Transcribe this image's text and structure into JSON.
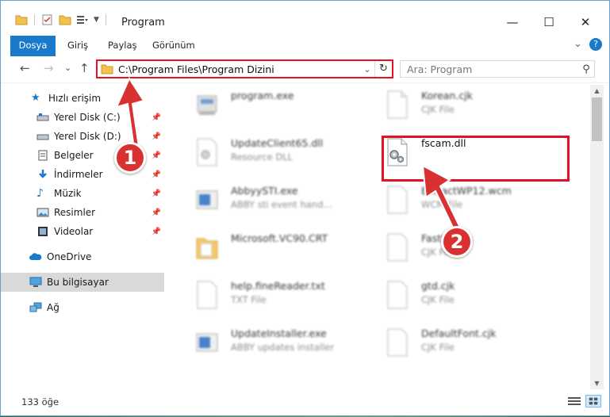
{
  "window": {
    "title": "Program",
    "controls": {
      "minimize": "—",
      "maximize": "☐",
      "close": "✕"
    }
  },
  "ribbon": {
    "tabs": [
      "Dosya",
      "Giriş",
      "Paylaş",
      "Görünüm"
    ],
    "collapse_icon": "chevron-down-icon",
    "help_icon": "help-icon"
  },
  "navbar": {
    "back": "←",
    "forward": "→",
    "recent": "⌄",
    "up": "↑",
    "address": "C:\\Program Files\\Program Dizini",
    "search_placeholder": "Ara: Program"
  },
  "sidebar": {
    "items": [
      {
        "label": "Hızlı erişim",
        "icon": "star-icon",
        "pinned": false
      },
      {
        "label": "Yerel Disk (C:)",
        "icon": "drive-icon",
        "pinned": true
      },
      {
        "label": "Yerel Disk (D:)",
        "icon": "drive-icon",
        "pinned": true
      },
      {
        "label": "Belgeler",
        "icon": "documents-icon",
        "pinned": true
      },
      {
        "label": "İndirmeler",
        "icon": "download-icon",
        "pinned": true
      },
      {
        "label": "Müzik",
        "icon": "music-icon",
        "pinned": true
      },
      {
        "label": "Resimler",
        "icon": "pictures-icon",
        "pinned": true
      },
      {
        "label": "Videolar",
        "icon": "video-icon",
        "pinned": true
      },
      {
        "label": "OneDrive",
        "icon": "cloud-icon",
        "pinned": false
      },
      {
        "label": "Bu bilgisayar",
        "icon": "computer-icon",
        "pinned": false,
        "selected": true
      },
      {
        "label": "Ağ",
        "icon": "network-icon",
        "pinned": false
      }
    ]
  },
  "files": [
    {
      "name": "program.exe",
      "type": "",
      "icon": "exe-icon"
    },
    {
      "name": "Korean.cjk",
      "type": "CJK File",
      "icon": "file-icon"
    },
    {
      "name": "UpdateClient65.dll",
      "type": "Resource DLL",
      "icon": "dll-icon"
    },
    {
      "name": "fscam.dll",
      "type": "",
      "icon": "dll-gear-icon",
      "highlighted": true
    },
    {
      "name": "AbbyySTI.exe",
      "type": "ABBY sti event hand...",
      "icon": "app-icon"
    },
    {
      "name": "ExtractWP12.wcm",
      "type": "WCM File",
      "icon": "file-icon"
    },
    {
      "name": "Microsoft.VC90.CRT",
      "type": "",
      "icon": "folder-icon"
    },
    {
      "name": "FastImage",
      "type": "CJK File",
      "icon": "file-icon"
    },
    {
      "name": "help.fineReader.txt",
      "type": "TXT File",
      "icon": "txt-icon"
    },
    {
      "name": "gtd.cjk",
      "type": "CJK File",
      "icon": "file-icon"
    },
    {
      "name": "UpdateInstaller.exe",
      "type": "ABBY updates installer",
      "icon": "app-icon"
    },
    {
      "name": "DefaultFont.cjk",
      "type": "CJK File",
      "icon": "file-icon"
    }
  ],
  "status": {
    "count": "133 öğe"
  },
  "annotations": [
    "1",
    "2"
  ],
  "colors": {
    "accent": "#1979ca",
    "highlight": "#e81123",
    "badge": "#d93131"
  }
}
